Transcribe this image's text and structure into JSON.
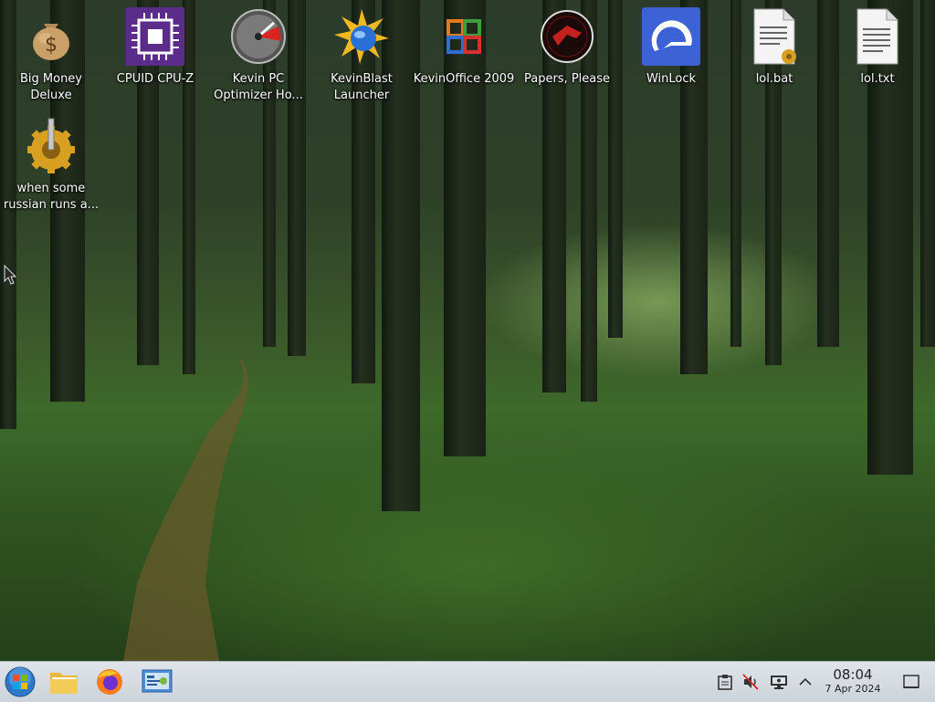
{
  "desktop": {
    "icons": [
      {
        "label": "Big Money Deluxe",
        "icon": "money-bag-icon"
      },
      {
        "label": "CPUID CPU-Z",
        "icon": "cpu-chip-icon"
      },
      {
        "label": "Kevin PC Optimizer Ho...",
        "icon": "speedometer-icon"
      },
      {
        "label": "KevinBlast Launcher",
        "icon": "starburst-globe-icon"
      },
      {
        "label": "KevinOffice 2009",
        "icon": "office-logo-icon"
      },
      {
        "label": "Papers, Please",
        "icon": "papers-please-emblem-icon"
      },
      {
        "label": "WinLock",
        "icon": "winlock-icon"
      },
      {
        "label": "lol.bat",
        "icon": "batch-file-icon"
      },
      {
        "label": "lol.txt",
        "icon": "text-file-icon"
      },
      {
        "label": "when some russian runs a...",
        "icon": "gear-executable-icon"
      }
    ]
  },
  "taskbar": {
    "pinned": [
      {
        "name": "start-button",
        "icon": "windows-orb-icon"
      },
      {
        "name": "file-explorer",
        "icon": "folder-icon"
      },
      {
        "name": "firefox",
        "icon": "firefox-icon"
      },
      {
        "name": "control-panel",
        "icon": "control-panel-icon"
      }
    ],
    "tray": [
      {
        "name": "clipboard",
        "icon": "clipboard-icon"
      },
      {
        "name": "volume-muted",
        "icon": "speaker-muted-icon"
      },
      {
        "name": "network",
        "icon": "network-monitor-icon"
      },
      {
        "name": "show-hidden-icons",
        "icon": "chevron-up-icon"
      }
    ],
    "clock": {
      "time": "08:04",
      "date": "7 Apr 2024"
    }
  },
  "colors": {
    "taskbar": "#d6dce2",
    "label_text": "#ffffff"
  }
}
